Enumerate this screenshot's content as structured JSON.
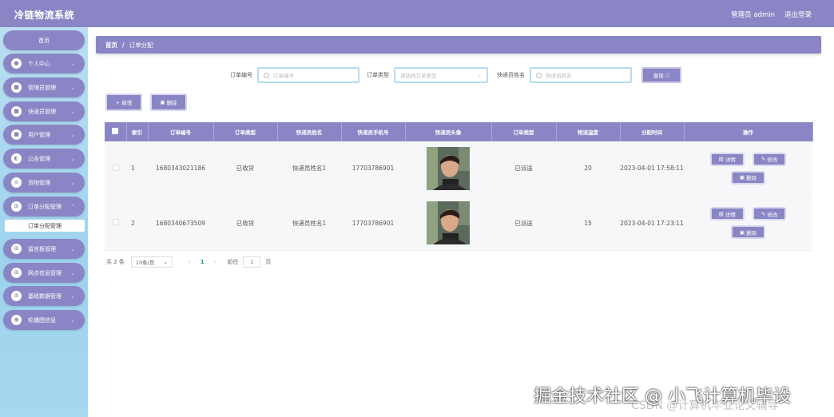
{
  "header": {
    "title": "冷链物流系统",
    "user": "管理员 admin",
    "logout": "退出登录"
  },
  "sidebar": {
    "home": "首页",
    "items": [
      {
        "label": "个人中心",
        "icon": "person-icon"
      },
      {
        "label": "管理员管理",
        "icon": "admin-icon"
      },
      {
        "label": "快递员管理",
        "icon": "courier-icon"
      },
      {
        "label": "用户管理",
        "icon": "user-icon"
      },
      {
        "label": "公告管理",
        "icon": "notice-icon"
      },
      {
        "label": "货物管理",
        "icon": "goods-icon"
      },
      {
        "label": "订单分配管理",
        "icon": "grid-icon"
      },
      {
        "label": "留言板管理",
        "icon": "grid-icon"
      },
      {
        "label": "网点信息管理",
        "icon": "grid-icon"
      },
      {
        "label": "基础数据管理",
        "icon": "grid-icon"
      },
      {
        "label": "轮播图信息",
        "icon": "image-icon"
      }
    ],
    "active_sub": "订单分配管理"
  },
  "breadcrumb": {
    "home": "首页",
    "sep": "/",
    "current": "订单分配"
  },
  "search": {
    "order_no_label": "订单编号",
    "order_no_placeholder": "订单编号",
    "order_type_label": "订单类型",
    "order_type_placeholder": "请选择订单类型",
    "courier_label": "快递员姓名",
    "courier_placeholder": "快递员姓名",
    "query": "查询"
  },
  "actions": {
    "add": "+ 新增",
    "delete": "删除"
  },
  "table": {
    "headers": [
      "索引",
      "订单编号",
      "订单类型",
      "快递员姓名",
      "快递员手机号",
      "快递员头像",
      "订单类型",
      "物流温度",
      "分配时间",
      "操作"
    ],
    "rows": [
      {
        "index": "1",
        "order_no": "1680343021186",
        "type": "已收货",
        "courier": "快递员姓名1",
        "phone": "17703786901",
        "status": "已派送",
        "temp": "20",
        "time": "2023-04-01 17:58:11"
      },
      {
        "index": "2",
        "order_no": "1680340673509",
        "type": "已收货",
        "courier": "快递员姓名1",
        "phone": "17703786901",
        "status": "已派送",
        "temp": "15",
        "time": "2023-04-01 17:23:11"
      }
    ],
    "op_detail": "详情",
    "op_edit": "修改",
    "op_delete": "删除"
  },
  "pager": {
    "total": "共 2 条",
    "page_size": "10条/页",
    "prev": "‹",
    "current": "1",
    "next": "›",
    "goto": "前往",
    "goto_value": "1",
    "page_unit": "页"
  },
  "watermark": {
    "main": "掘金技术社区 @ 小飞计算机毕设",
    "sub": "CSDN @计算机毕业论文辅导"
  }
}
